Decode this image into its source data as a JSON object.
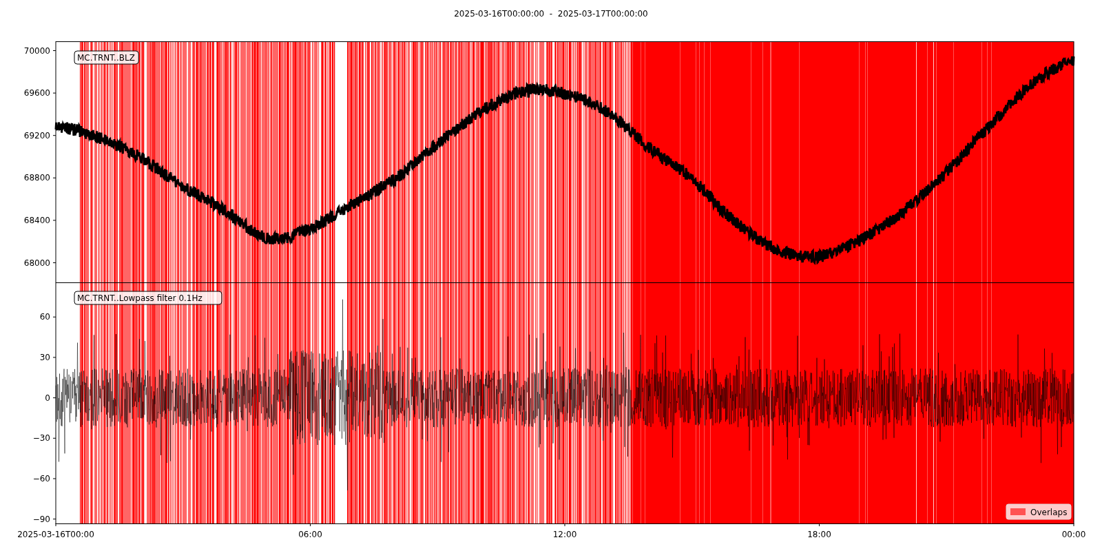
{
  "title": "2025-03-16T00:00:00  -  2025-03-17T00:00:00",
  "panels": [
    {
      "label": "MC.TRNT..BLZ",
      "kind": "trace",
      "yticks": [
        "70000",
        "69600",
        "69200",
        "68800",
        "68400",
        "68000"
      ]
    },
    {
      "label": "MC.TRNT..Lowpass filter 0.1Hz",
      "kind": "noise",
      "yticks": [
        "60",
        "30",
        "0",
        "−30",
        "−60",
        "−90"
      ]
    }
  ],
  "xticks": [
    "2025-03-16T00:00",
    "06:00",
    "12:00",
    "18:00",
    "00:00"
  ],
  "legend": {
    "label": "Overlaps"
  }
}
